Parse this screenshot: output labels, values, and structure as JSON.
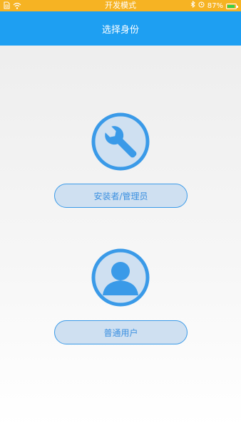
{
  "status_bar": {
    "mode_text": "开发模式",
    "battery_text": "87%",
    "battery_level": 0.87,
    "icons": [
      "sim-icon",
      "wifi-icon",
      "bluetooth-icon",
      "alarm-icon",
      "battery-icon"
    ]
  },
  "header": {
    "title": "选择身份"
  },
  "roles": {
    "installer": {
      "label": "安装者/管理员",
      "icon": "wrench-icon"
    },
    "user": {
      "label": "普通用户",
      "icon": "user-icon"
    }
  },
  "colors": {
    "status_bar": "#f6b323",
    "title_bar": "#1e9ff2",
    "accent": "#3a9ae8",
    "button_fill": "#cfe0f1"
  }
}
